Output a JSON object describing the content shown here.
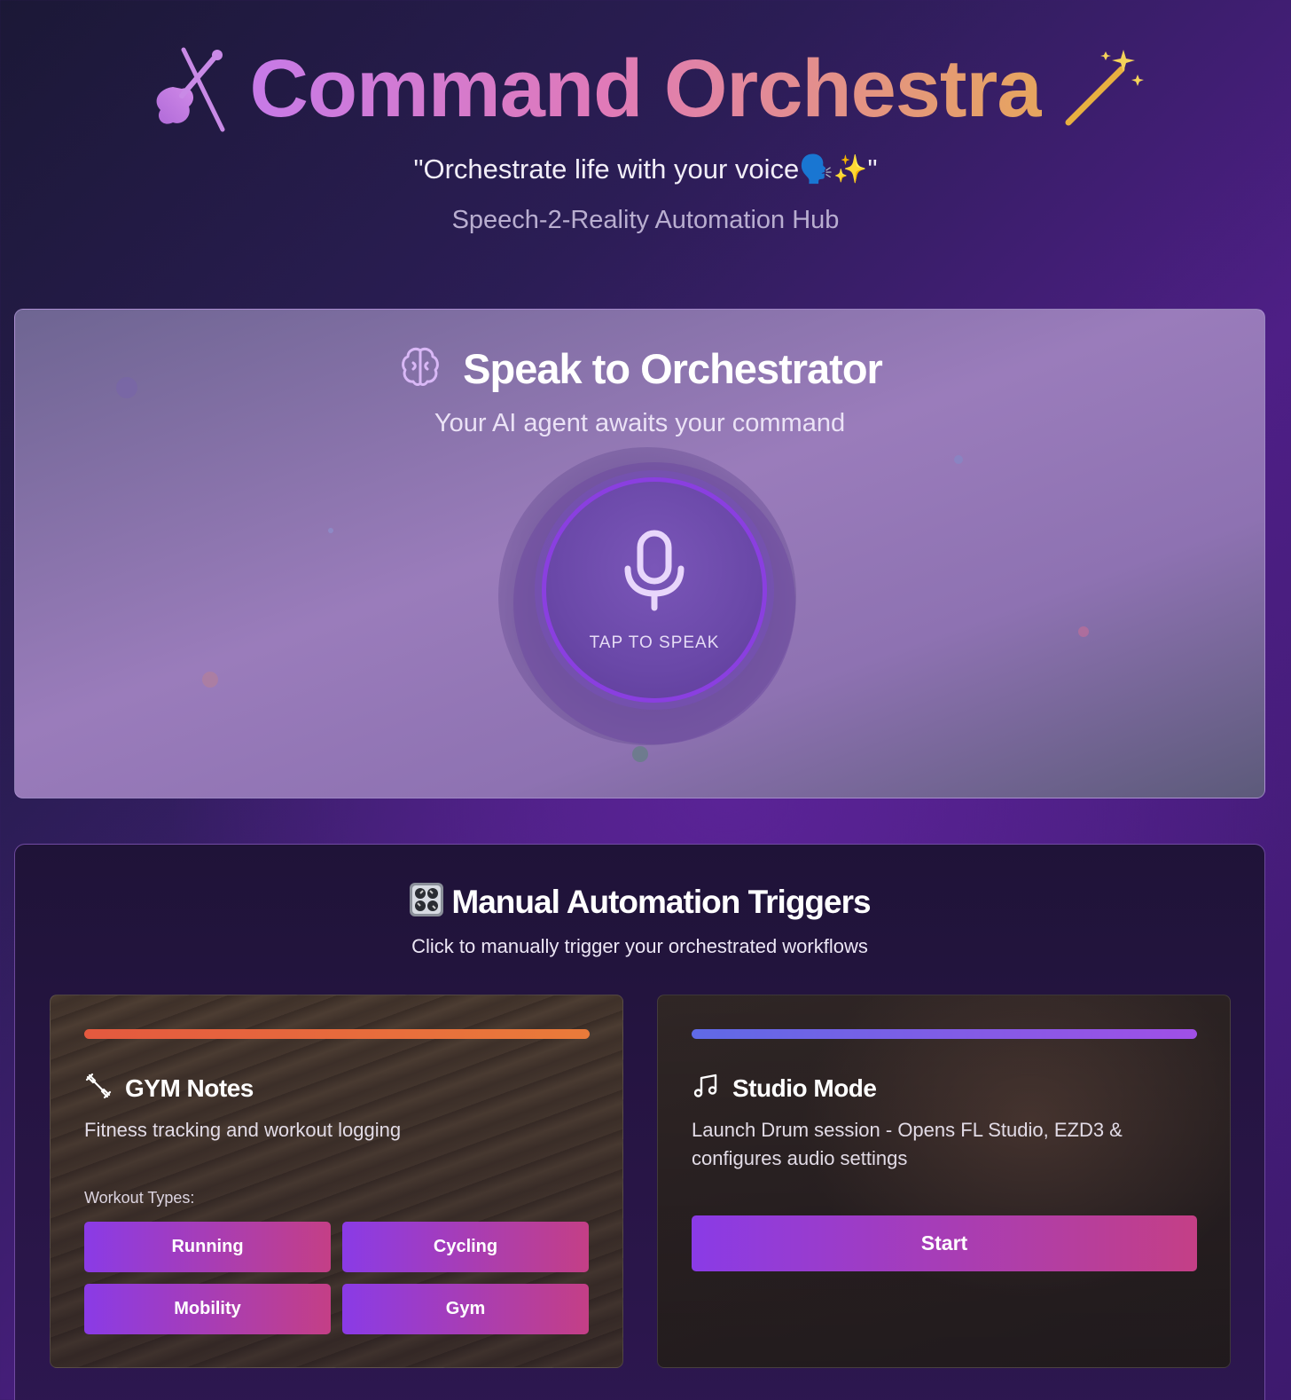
{
  "header": {
    "title": "Command Orchestra",
    "title_icon": "violin-icon",
    "title_trailing_icon": "magic-wand-icon",
    "tagline": "\"Orchestrate life with your voice🗣️✨\"",
    "subtitle": "Speech-2-Reality Automation Hub"
  },
  "voice": {
    "icon": "brain-icon",
    "title": "Speak to Orchestrator",
    "subtitle": "Your AI agent awaits your command",
    "mic_label": "TAP TO SPEAK"
  },
  "manual": {
    "icon": "control-knobs-icon",
    "title": "Manual Automation Triggers",
    "subtitle": "Click to manually trigger your orchestrated workflows",
    "cards": [
      {
        "icon": "dumbbell-icon",
        "title": "GYM Notes",
        "description": "Fitness tracking and workout logging",
        "workout_label": "Workout Types:",
        "workouts": [
          "Running",
          "Cycling",
          "Mobility",
          "Gym"
        ]
      },
      {
        "icon": "music-note-icon",
        "title": "Studio Mode",
        "description": "Launch Drum session - Opens FL Studio, EZD3 & configures audio settings",
        "button_label": "Start"
      }
    ]
  },
  "colors": {
    "title_gradient": [
      "#c77ae8",
      "#e07ab8",
      "#e6a55e"
    ],
    "button_gradient": [
      "#8a3be6",
      "#c43f86"
    ],
    "gym_bar": [
      "#e4593f",
      "#ea7b3a"
    ],
    "studio_bar": [
      "#5f6ae6",
      "#a04fe6"
    ],
    "mic_ring": "#8a3fe0"
  }
}
